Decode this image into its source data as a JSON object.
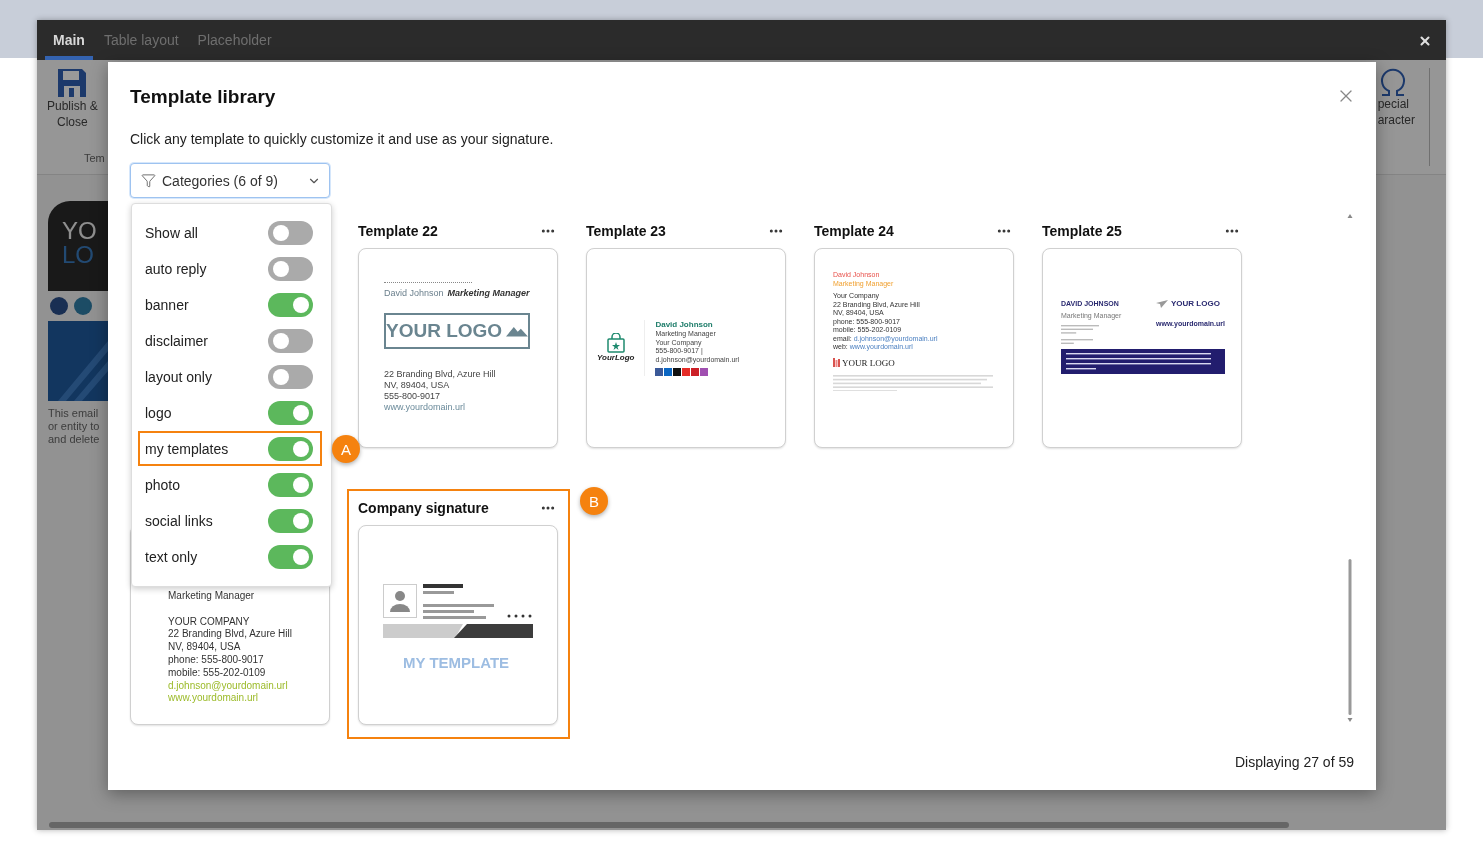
{
  "editor": {
    "tabs": [
      {
        "label": "Main",
        "selected": true
      },
      {
        "label": "Table layout",
        "selected": false
      },
      {
        "label": "Placeholder",
        "selected": false
      }
    ],
    "ribbon": {
      "publish": [
        "Publish &",
        "Close"
      ],
      "group_label": "Tem",
      "special": [
        "pecial",
        "aracter"
      ]
    },
    "preview": {
      "logo": [
        "YO",
        "LO"
      ],
      "disclaimer": [
        "This email",
        "or entity to",
        "and delete"
      ]
    }
  },
  "modal": {
    "title": "Template library",
    "subtitle": "Click any template to quickly customize it and use as your signature.",
    "categories": {
      "label": "Categories (6 of 9)",
      "expanded": true,
      "options": [
        {
          "label": "Show all",
          "on": false
        },
        {
          "label": "auto reply",
          "on": false
        },
        {
          "label": "banner",
          "on": true
        },
        {
          "label": "disclaimer",
          "on": false
        },
        {
          "label": "layout only",
          "on": false
        },
        {
          "label": "logo",
          "on": true
        },
        {
          "label": "my templates",
          "on": true,
          "callout": "A"
        },
        {
          "label": "photo",
          "on": true
        },
        {
          "label": "social links",
          "on": true
        },
        {
          "label": "text only",
          "on": true
        }
      ]
    },
    "templates": [
      {
        "title": "Template 22",
        "kind": "logo-box",
        "name": "David Johnson",
        "role": "Marketing Manager",
        "logo": "YOUR LOGO",
        "lines": [
          "22 Branding Blvd, Azure Hill",
          "NV, 89404, USA",
          "555-800-9017"
        ],
        "link": "www.yourdomain.url"
      },
      {
        "title": "Template 23",
        "kind": "side-logo",
        "logo": "YourLogo",
        "name": "David Johnson",
        "lines": [
          "Marketing Manager",
          "Your Company",
          "555-800-9017 | d.johnson@yourdomain.url"
        ]
      },
      {
        "title": "Template 24",
        "kind": "stacked",
        "name": "David Johnson",
        "role": "Marketing Manager",
        "lines": [
          "Your Company",
          "22 Branding Blvd, Azure Hill",
          "NV, 89404, USA",
          "phone: 555-800-9017",
          "mobile: 555-202-0109"
        ],
        "contacts": [
          {
            "label": "email:",
            "value": "d.johnson@yourdomain.url"
          },
          {
            "label": "web:",
            "value": "www.yourdomain.url"
          }
        ],
        "logo": "YOUR LOGO"
      },
      {
        "title": "Template 25",
        "kind": "banner",
        "name": "DAVID JOHNSON",
        "role": "Marketing Manager",
        "logo": "YOUR LOGO",
        "link": "www.yourdomain.url"
      },
      {
        "kind": "text-only",
        "lines": [
          "Marketing Manager"
        ],
        "company": [
          "YOUR COMPANY",
          "22 Branding Blvd, Azure Hill",
          "NV, 89404, USA",
          "phone: 555-800-9017",
          "mobile: 555-202-0109"
        ],
        "links": [
          "d.johnson@yourdomain.url",
          "www.yourdomain.url"
        ]
      },
      {
        "title": "Company signature",
        "kind": "my-template",
        "caption": "MY TEMPLATE",
        "callout": "B"
      }
    ],
    "status": "Displaying 27 of 59"
  }
}
